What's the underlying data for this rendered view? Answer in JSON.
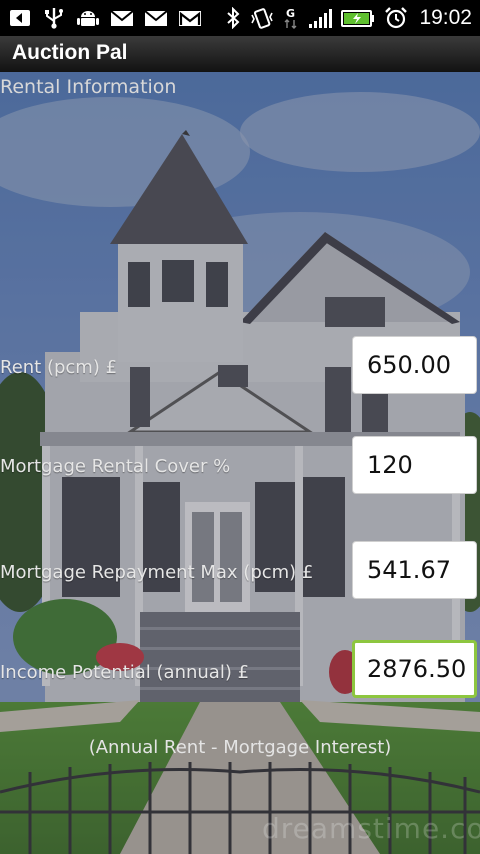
{
  "status_bar": {
    "time": "19:02",
    "icons_left": [
      "back-arrow-icon",
      "usb-icon",
      "android-debug-icon",
      "mail-icon",
      "mail-icon",
      "gmail-icon"
    ],
    "icons_right": [
      "bluetooth-icon",
      "vibrate-icon",
      "gprs-data-icon",
      "signal-strength-icon",
      "battery-charging-icon",
      "alarm-clock-icon"
    ],
    "data_type_label": "G"
  },
  "app": {
    "title": "Auction Pal"
  },
  "section": {
    "title": "Rental Information"
  },
  "fields": [
    {
      "label": "Rent (pcm) £",
      "value": "650.00"
    },
    {
      "label": "Mortgage Rental Cover %",
      "value": "120"
    },
    {
      "label": "Mortgage Repayment Max (pcm) £",
      "value": "541.67"
    },
    {
      "label": "Income Potential (annual) £",
      "value": "2876.50"
    }
  ],
  "footnote": "(Annual Rent - Mortgage Interest)",
  "watermark": "dreamstime.com",
  "colors": {
    "focus_border": "#8dc63f",
    "field_bg": "#ffffff",
    "title_bar": "#1e1e1e"
  }
}
